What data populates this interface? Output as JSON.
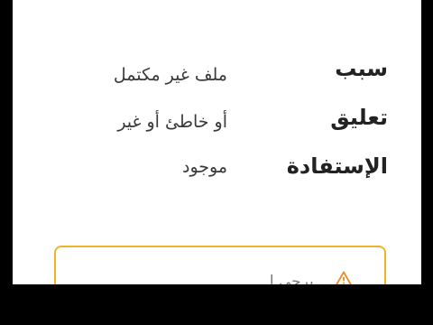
{
  "details": {
    "reason_label": "سبب",
    "reason_value": "ملف غير مكتمل",
    "comment_label": "تعليق",
    "comment_value": "أو خاطئ أو غير",
    "benefit_label": "الإستفادة",
    "benefit_value": "موجود"
  },
  "notice": {
    "icon": "warning-icon",
    "text": "...يرجى إ",
    "border_color": "#f0b429"
  }
}
